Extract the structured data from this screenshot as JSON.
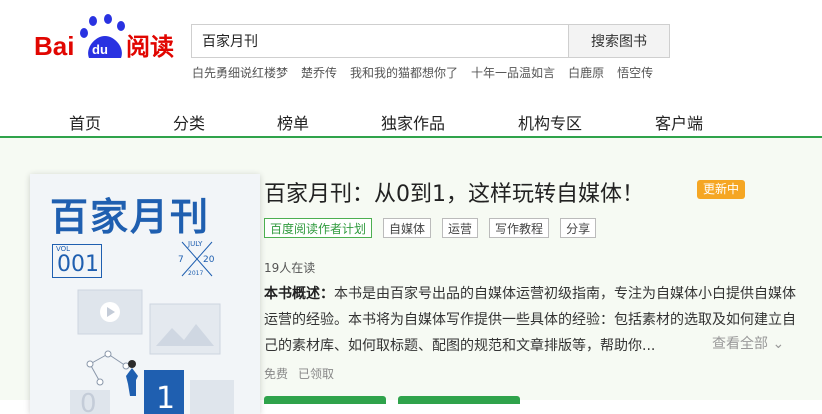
{
  "logo": {
    "text_bai": "Bai",
    "text_du": "du",
    "text_read": "阅读"
  },
  "search": {
    "value": "百家月刊",
    "button": "搜索图书"
  },
  "hot_links": [
    "白先勇细说红楼梦",
    "楚乔传",
    "我和我的猫都想你了",
    "十年一品温如言",
    "白鹿原",
    "悟空传"
  ],
  "nav": [
    "首页",
    "分类",
    "榜单",
    "独家作品",
    "机构专区",
    "客户端"
  ],
  "cover": {
    "title": "百家月刊",
    "vol_label": "VOL",
    "vol_number": "001",
    "month": "JULY",
    "day1": "7",
    "day2": "20",
    "year": "2017",
    "tile_zero": "0",
    "tile_one": "1"
  },
  "book": {
    "title": "百家月刊：从0到1，这样玩转自媒体！",
    "status": "更新中",
    "tags": [
      "百度阅读作者计划",
      "自媒体",
      "运营",
      "写作教程",
      "分享"
    ],
    "readers": "19人在读",
    "summary_label": "本书概述：",
    "summary": "本书是由百家号出品的自媒体运营初级指南，专注为自媒体小白提供自媒体运营的经验。本书将为自媒体写作提供一些具体的经验：包括素材的选取及如何建立自己的素材库、如何取标题、配图的规范和文章排版等，帮助你...",
    "more": "查看全部",
    "price": "免费",
    "claimed": "已领取"
  },
  "colors": {
    "brand_red": "#e10601",
    "brand_blue": "#2932e1",
    "accent_green": "#2fa34b",
    "badge_orange": "#f5a623",
    "cover_blue": "#1f5fb0"
  }
}
